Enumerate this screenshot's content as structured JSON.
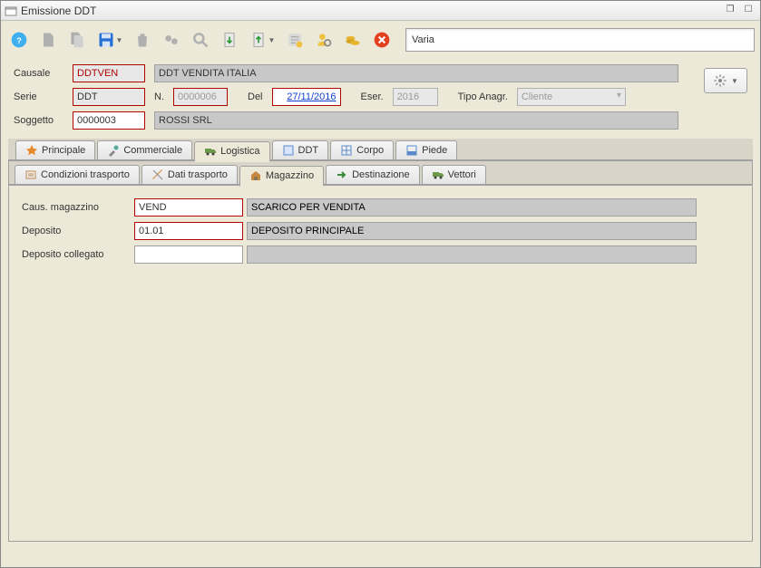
{
  "window": {
    "title": "Emissione DDT"
  },
  "toolbar": {
    "context_field": "Varia"
  },
  "header": {
    "causale_label": "Causale",
    "causale_value": "DDTVEN",
    "causale_desc": "DDT VENDITA ITALIA",
    "serie_label": "Serie",
    "serie_value": "DDT",
    "numero_label": "N.",
    "numero_value": "0000006",
    "del_label": "Del",
    "del_value": "27/11/2016",
    "eser_label": "Eser.",
    "eser_value": "2016",
    "tipo_anagr_label": "Tipo Anagr.",
    "tipo_anagr_value": "Cliente",
    "soggetto_label": "Soggetto",
    "soggetto_value": "0000003",
    "soggetto_desc": "ROSSI SRL"
  },
  "tabs": {
    "main": [
      "Principale",
      "Commerciale",
      "Logistica",
      "DDT",
      "Corpo",
      "Piede"
    ],
    "sub": [
      "Condizioni trasporto",
      "Dati trasporto",
      "Magazzino",
      "Destinazione",
      "Vettori"
    ]
  },
  "magazzino": {
    "caus_label": "Caus. magazzino",
    "caus_value": "VEND",
    "caus_desc": "SCARICO PER VENDITA",
    "deposito_label": "Deposito",
    "deposito_value": "01.01",
    "deposito_desc": "DEPOSITO PRINCIPALE",
    "dep_coll_label": "Deposito collegato",
    "dep_coll_value": ""
  }
}
